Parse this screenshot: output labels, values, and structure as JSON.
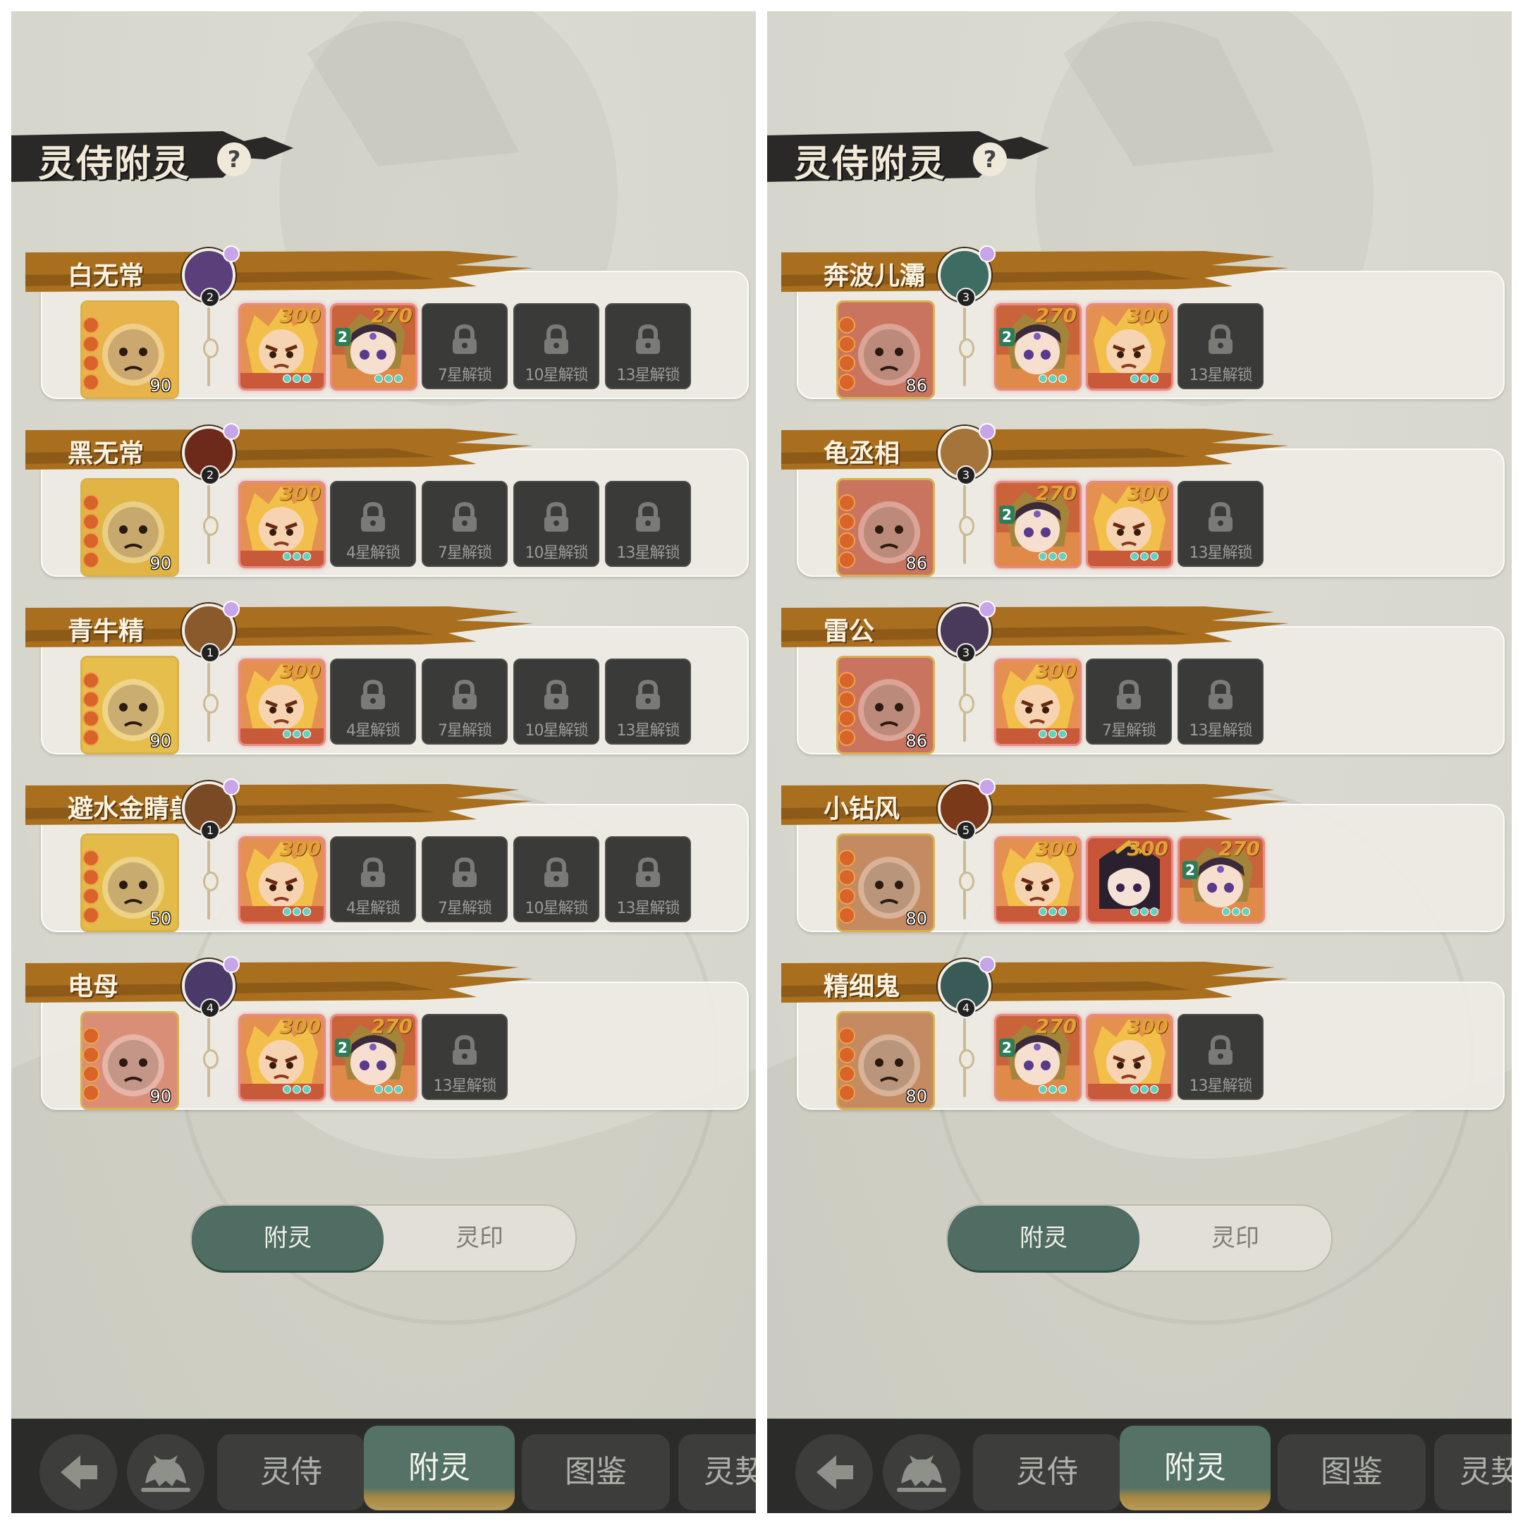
{
  "panels": [
    {
      "title": "灵侍附灵",
      "help_icon": "?",
      "sections": [
        {
          "name": "白无常",
          "emblem_level": "2",
          "emblem_color": "#5b3f7a",
          "portrait_level": "90",
          "portrait_bg": "#e8b34a",
          "slots": [
            {
              "type": "spirit",
              "value": "300",
              "tier": "",
              "variant": "lion"
            },
            {
              "type": "spirit",
              "value": "270",
              "tier": "2",
              "variant": "maiden"
            },
            {
              "type": "locked",
              "label": "7星解锁"
            },
            {
              "type": "locked",
              "label": "10星解锁"
            },
            {
              "type": "locked",
              "label": "13星解锁"
            }
          ]
        },
        {
          "name": "黑无常",
          "emblem_level": "2",
          "emblem_color": "#6d2a1a",
          "portrait_level": "90",
          "portrait_bg": "#e0b445",
          "slots": [
            {
              "type": "spirit",
              "value": "300",
              "tier": "",
              "variant": "lion"
            },
            {
              "type": "locked",
              "label": "4星解锁"
            },
            {
              "type": "locked",
              "label": "7星解锁"
            },
            {
              "type": "locked",
              "label": "10星解锁"
            },
            {
              "type": "locked",
              "label": "13星解锁"
            }
          ]
        },
        {
          "name": "青牛精",
          "emblem_level": "1",
          "emblem_color": "#8a5a2c",
          "portrait_level": "90",
          "portrait_bg": "#e6be4c",
          "slots": [
            {
              "type": "spirit",
              "value": "300",
              "tier": "",
              "variant": "lion"
            },
            {
              "type": "locked",
              "label": "4星解锁"
            },
            {
              "type": "locked",
              "label": "7星解锁"
            },
            {
              "type": "locked",
              "label": "10星解锁"
            },
            {
              "type": "locked",
              "label": "13星解锁"
            }
          ]
        },
        {
          "name": "避水金睛兽",
          "emblem_level": "1",
          "emblem_color": "#7a4a24",
          "portrait_level": "50",
          "portrait_bg": "#e3bb48",
          "slots": [
            {
              "type": "spirit",
              "value": "300",
              "tier": "",
              "variant": "lion"
            },
            {
              "type": "locked",
              "label": "4星解锁"
            },
            {
              "type": "locked",
              "label": "7星解锁"
            },
            {
              "type": "locked",
              "label": "10星解锁"
            },
            {
              "type": "locked",
              "label": "13星解锁"
            }
          ]
        },
        {
          "name": "电母",
          "emblem_level": "4",
          "emblem_color": "#4a3a6a",
          "portrait_level": "90",
          "portrait_bg": "#d98e78",
          "slots": [
            {
              "type": "spirit",
              "value": "300",
              "tier": "",
              "variant": "lion"
            },
            {
              "type": "spirit",
              "value": "270",
              "tier": "2",
              "variant": "maiden"
            },
            {
              "type": "locked",
              "label": "13星解锁"
            }
          ]
        }
      ],
      "toggle": {
        "active": "附灵",
        "inactive": "灵印"
      },
      "nav": {
        "back_icon": "back-arrow-icon",
        "creature_icon": "creature-icon",
        "tab1": "灵侍",
        "tab2": "附灵",
        "tab3": "图鉴",
        "tab4": "灵契"
      }
    },
    {
      "title": "灵侍附灵",
      "help_icon": "?",
      "sections": [
        {
          "name": "奔波儿灞",
          "emblem_level": "3",
          "emblem_color": "#3e6b62",
          "portrait_level": "86",
          "portrait_bg": "#c9745f",
          "slots": [
            {
              "type": "spirit",
              "value": "270",
              "tier": "2",
              "variant": "maiden"
            },
            {
              "type": "spirit",
              "value": "300",
              "tier": "",
              "variant": "lion"
            },
            {
              "type": "locked",
              "label": "13星解锁"
            }
          ]
        },
        {
          "name": "龟丞相",
          "emblem_level": "3",
          "emblem_color": "#a4743a",
          "portrait_level": "86",
          "portrait_bg": "#c9745f",
          "slots": [
            {
              "type": "spirit",
              "value": "270",
              "tier": "2",
              "variant": "maiden"
            },
            {
              "type": "spirit",
              "value": "300",
              "tier": "",
              "variant": "lion"
            },
            {
              "type": "locked",
              "label": "13星解锁"
            }
          ]
        },
        {
          "name": "雷公",
          "emblem_level": "3",
          "emblem_color": "#4a3a5a",
          "portrait_level": "86",
          "portrait_bg": "#c9745f",
          "slots": [
            {
              "type": "spirit",
              "value": "300",
              "tier": "",
              "variant": "lion"
            },
            {
              "type": "locked",
              "label": "7星解锁"
            },
            {
              "type": "locked",
              "label": "13星解锁"
            }
          ]
        },
        {
          "name": "小钻风",
          "emblem_level": "5",
          "emblem_color": "#7a3a1a",
          "portrait_level": "80",
          "portrait_bg": "#c48a62",
          "slots": [
            {
              "type": "spirit",
              "value": "300",
              "tier": "",
              "variant": "lion"
            },
            {
              "type": "spirit",
              "value": "300",
              "tier": "",
              "variant": "dark"
            },
            {
              "type": "spirit",
              "value": "270",
              "tier": "2",
              "variant": "maiden"
            }
          ]
        },
        {
          "name": "精细鬼",
          "emblem_level": "4",
          "emblem_color": "#3a5a58",
          "portrait_level": "80",
          "portrait_bg": "#c48a62",
          "slots": [
            {
              "type": "spirit",
              "value": "270",
              "tier": "2",
              "variant": "maiden"
            },
            {
              "type": "spirit",
              "value": "300",
              "tier": "",
              "variant": "lion"
            },
            {
              "type": "locked",
              "label": "13星解锁"
            }
          ]
        }
      ],
      "toggle": {
        "active": "附灵",
        "inactive": "灵印"
      },
      "nav": {
        "back_icon": "back-arrow-icon",
        "creature_icon": "creature-icon",
        "tab1": "灵侍",
        "tab2": "附灵",
        "tab3": "图鉴",
        "tab4": "灵契"
      }
    }
  ]
}
